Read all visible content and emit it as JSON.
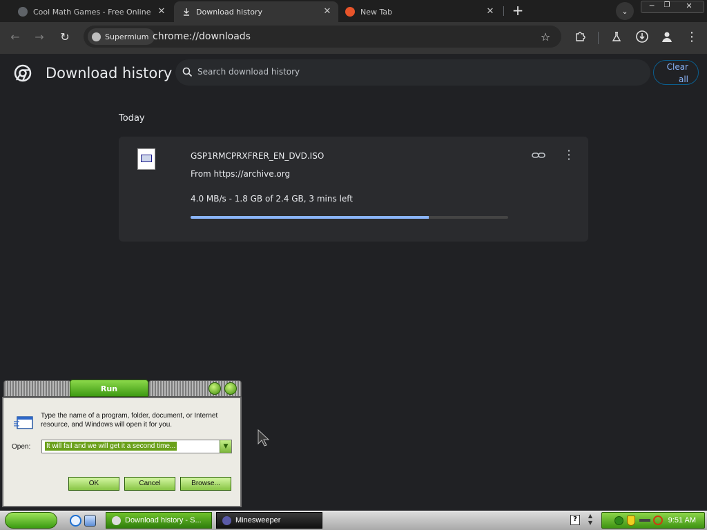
{
  "tabs": [
    {
      "title": "Cool Math Games - Free Online Ga",
      "active": false
    },
    {
      "title": "Download history",
      "active": true
    },
    {
      "title": "New Tab",
      "active": false
    }
  ],
  "omnibox": {
    "chip_label": "Supermium",
    "url": "chrome://downloads"
  },
  "page": {
    "title": "Download history",
    "search_placeholder": "Search download history",
    "clear_all_line1": "Clear",
    "clear_all_line2": "all",
    "section": "Today"
  },
  "download": {
    "filename": "GSP1RMCPRXFRER_EN_DVD.ISO",
    "source": "From https://archive.org",
    "status": "4.0 MB/s - 1.8 GB of 2.4 GB, 3 mins left",
    "progress_fraction": 0.75
  },
  "run_dialog": {
    "title": "Run",
    "message": "Type the name of a program, folder, document, or Internet resource, and Windows will open it for you.",
    "open_label": "Open:",
    "input_value": "It will fail and we will get it a second time...",
    "ok_label": "OK",
    "cancel_label": "Cancel",
    "browse_label": "Browse..."
  },
  "taskbar": {
    "items": [
      {
        "label": "Download history - S..."
      },
      {
        "label": "Minesweeper"
      }
    ],
    "clock": "9:51 AM"
  },
  "colors": {
    "accent": "#8ab4f8",
    "page_bg": "#202124",
    "xp_green": "#3e9a13"
  }
}
